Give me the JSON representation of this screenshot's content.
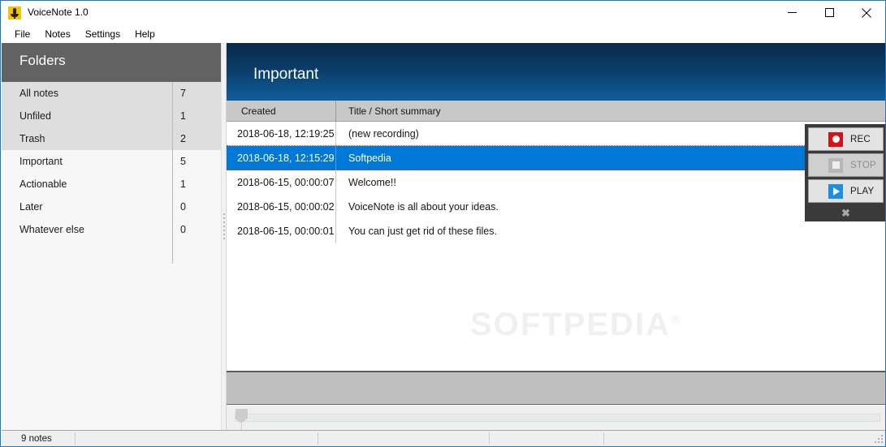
{
  "window": {
    "title": "VoiceNote 1.0",
    "icon": "microphone-icon",
    "minimize_label": "Minimize",
    "maximize_label": "Maximize",
    "close_label": "Close"
  },
  "menubar": {
    "items": [
      {
        "label": "File"
      },
      {
        "label": "Notes"
      },
      {
        "label": "Settings"
      },
      {
        "label": "Help"
      }
    ]
  },
  "sidebar": {
    "header": "Folders",
    "items": [
      {
        "label": "All notes",
        "count": "7",
        "group": "a"
      },
      {
        "label": "Unfiled",
        "count": "1",
        "group": "a"
      },
      {
        "label": "Trash",
        "count": "2",
        "group": "a"
      },
      {
        "label": "Important",
        "count": "5",
        "group": "b"
      },
      {
        "label": "Actionable",
        "count": "1",
        "group": "b"
      },
      {
        "label": "Later",
        "count": "0",
        "group": "b"
      },
      {
        "label": "Whatever else",
        "count": "0",
        "group": "b"
      }
    ]
  },
  "main": {
    "header_title": "Important",
    "columns": [
      {
        "label": "Created"
      },
      {
        "label": "Title / Short summary"
      }
    ],
    "rows": [
      {
        "created": "2018-06-18, 12:19:25",
        "title": "(new recording)",
        "selected": false
      },
      {
        "created": "2018-06-18, 12:15:29",
        "title": "Softpedia",
        "selected": true
      },
      {
        "created": "2018-06-15, 00:00:07",
        "title": "Welcome!!",
        "selected": false
      },
      {
        "created": "2018-06-15, 00:00:02",
        "title": "VoiceNote is all about your ideas.",
        "selected": false
      },
      {
        "created": "2018-06-15, 00:00:01",
        "title": "You can just get rid of these files.",
        "selected": false
      }
    ]
  },
  "transport": {
    "rec_label": "REC",
    "stop_label": "STOP",
    "play_label": "PLAY",
    "close_label": "✖",
    "rec_icon": "record-icon",
    "stop_icon": "stop-icon",
    "play_icon": "play-icon"
  },
  "statusbar": {
    "notes_count": "9 notes",
    "cell2": "",
    "cell3": "",
    "cell4": "",
    "cell5": ""
  },
  "watermark": {
    "text": "SOFTPEDIA",
    "mark": "®"
  },
  "colors": {
    "accent_selection": "#0078d7",
    "header_gradient_top": "#082a4c",
    "header_gradient_bottom": "#0e5f9c",
    "sidebar_header": "#626262",
    "record_red": "#d41317",
    "play_blue": "#1b8fe3",
    "window_border": "#1a7ac4",
    "focus_dotted": "#c0392b"
  }
}
